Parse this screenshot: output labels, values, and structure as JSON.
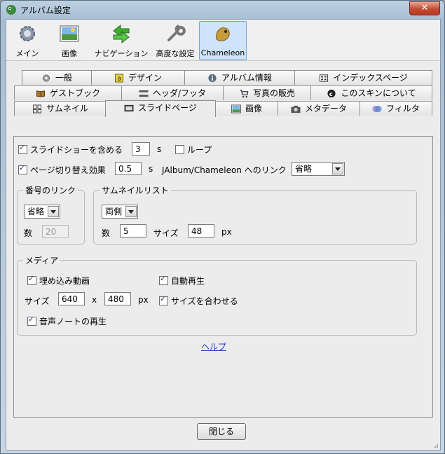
{
  "window": {
    "title": "アルバム設定",
    "close_glyph": "✕"
  },
  "toolbar": {
    "items": [
      {
        "label": "メイン",
        "icon": "gear-icon"
      },
      {
        "label": "画像",
        "icon": "image-icon"
      },
      {
        "label": "ナビゲーション",
        "icon": "arrows-icon"
      },
      {
        "label": "高度な設定",
        "icon": "wrench-icon"
      },
      {
        "label": "Chameleon",
        "icon": "chameleon-icon"
      }
    ]
  },
  "tabs": {
    "row1": [
      "一般",
      "デザイン",
      "アルバム情報",
      "インデックスページ"
    ],
    "row2": [
      "ゲストブック",
      "ヘッダ/フッタ",
      "写真の販売",
      "このスキンについて"
    ],
    "row3": [
      "サムネイル",
      "スライドページ",
      "画像",
      "メタデータ",
      "フィルタ"
    ],
    "active": "スライドページ"
  },
  "slide": {
    "include_slideshow_label": "スライドショーを含める",
    "include_slideshow_checked": true,
    "slideshow_value": "3",
    "slideshow_unit": "s",
    "loop_label": "ループ",
    "loop_checked": false,
    "transition_label": "ページ切り替え効果",
    "transition_checked": true,
    "transition_value": "0.5",
    "transition_unit": "s",
    "jalbum_link_label": "JAlbum/Chameleon へのリンク",
    "jalbum_link_value": "省略"
  },
  "number_link": {
    "legend": "番号のリンク",
    "select_value": "省略",
    "count_label": "数",
    "count_value": "20"
  },
  "thumb_list": {
    "legend": "サムネイルリスト",
    "select_value": "両側",
    "count_label": "数",
    "count_value": "5",
    "size_label": "サイズ",
    "size_value": "48",
    "size_unit": "px"
  },
  "media": {
    "legend": "メディア",
    "embed_video_label": "埋め込み動画",
    "embed_video_checked": true,
    "autoplay_label": "自動再生",
    "autoplay_checked": true,
    "size_label": "サイズ",
    "width_value": "640",
    "x_label": "x",
    "height_value": "480",
    "px_label": "px",
    "fit_size_label": "サイズを合わせる",
    "fit_size_checked": true,
    "voice_note_label": "音声ノートの再生",
    "voice_note_checked": true
  },
  "help_link": "ヘルプ",
  "close_button": "閉じる"
}
